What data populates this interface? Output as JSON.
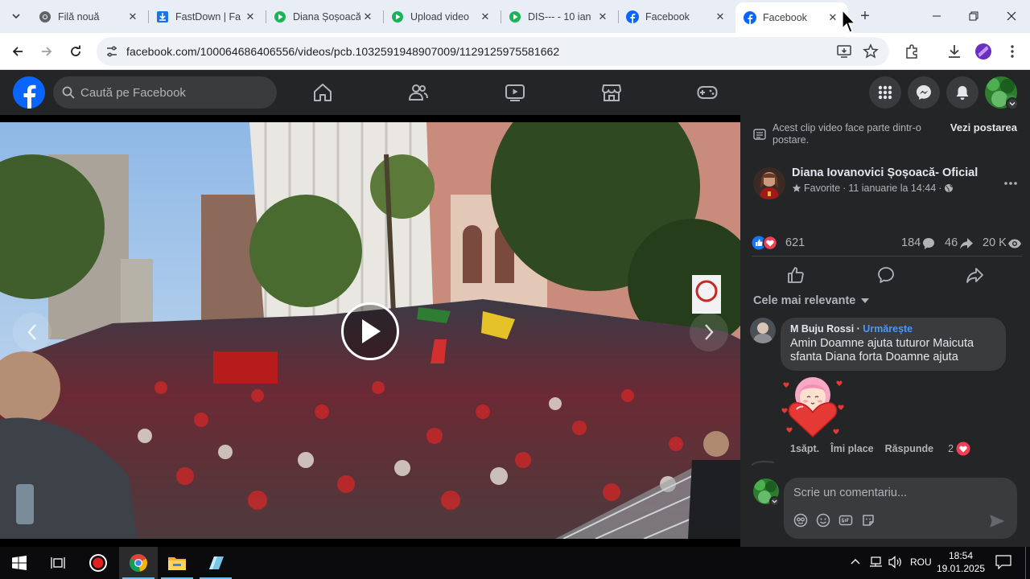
{
  "browser": {
    "tabs": [
      {
        "title": "Filă nouă",
        "favicon": "chrome-icon"
      },
      {
        "title": "FastDown | Fa",
        "favicon": "download-icon"
      },
      {
        "title": "Diana Șoșoacă",
        "favicon": "green-play-icon"
      },
      {
        "title": "Upload video",
        "favicon": "green-play-icon"
      },
      {
        "title": "DIS--- - 10 ian",
        "favicon": "green-play-icon"
      },
      {
        "title": "Facebook",
        "favicon": "facebook-icon"
      },
      {
        "title": "Facebook",
        "favicon": "facebook-icon",
        "active": true
      }
    ],
    "url": "facebook.com/100064686406556/videos/pcb.1032591948907009/1129125975581662"
  },
  "facebook": {
    "search_placeholder": "Caută pe Facebook",
    "colors": {
      "brand": "#0866ff",
      "bg": "#242526",
      "surface": "#3a3b3c",
      "link": "#4599ff"
    }
  },
  "panel": {
    "notice": "Acest clip video face parte dintr-o postare.",
    "see_post": "Vezi postarea",
    "author": "Diana Iovanovici Șoșoacă- Oficial",
    "meta_favorite": "Favorite",
    "meta_date": "11 ianuarie la 14:44",
    "stats": {
      "reactions": "621",
      "comments": "184",
      "shares": "46",
      "views": "20 K"
    },
    "sort_label": "Cele mai relevante",
    "comment": {
      "name": "M Buju Rossi",
      "follow": "Urmărește",
      "text": "Amin Doamne ajuta tuturor Maicuta sfanta Diana forta Doamne ajuta",
      "time": "1săpt.",
      "like": "Îmi place",
      "reply": "Răspunde",
      "reactions": "2"
    },
    "compose_placeholder": "Scrie un comentariu..."
  },
  "taskbar": {
    "language": "ROU",
    "time": "18:54",
    "date": "19.01.2025"
  }
}
